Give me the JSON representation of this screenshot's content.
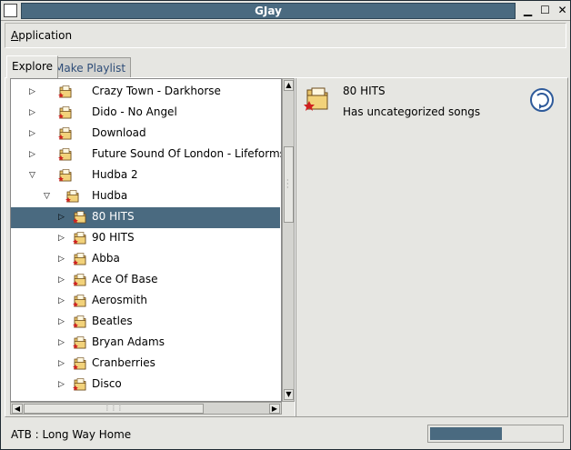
{
  "window": {
    "title": "GJay"
  },
  "menubar": {
    "application_label": "Application"
  },
  "tabs": [
    {
      "label": "Explore",
      "active": true
    },
    {
      "label": "Make Playlist",
      "active": false
    }
  ],
  "tree": {
    "rows": [
      {
        "label": "Crazy Town - Darkhorse",
        "depth": 0,
        "expanded": false,
        "selected": false
      },
      {
        "label": "Dido - No Angel",
        "depth": 0,
        "expanded": false,
        "selected": false
      },
      {
        "label": "Download",
        "depth": 0,
        "expanded": false,
        "selected": false
      },
      {
        "label": "Future Sound Of London - Lifeforms",
        "depth": 0,
        "expanded": false,
        "selected": false
      },
      {
        "label": "Hudba 2",
        "depth": 0,
        "expanded": true,
        "selected": false
      },
      {
        "label": "Hudba",
        "depth": 1,
        "expanded": true,
        "selected": false
      },
      {
        "label": "80 HITS",
        "depth": 2,
        "expanded": false,
        "selected": true
      },
      {
        "label": "90 HITS",
        "depth": 2,
        "expanded": false,
        "selected": false
      },
      {
        "label": "Abba",
        "depth": 2,
        "expanded": false,
        "selected": false
      },
      {
        "label": "Ace Of Base",
        "depth": 2,
        "expanded": false,
        "selected": false
      },
      {
        "label": "Aerosmith",
        "depth": 2,
        "expanded": false,
        "selected": false
      },
      {
        "label": "Beatles",
        "depth": 2,
        "expanded": false,
        "selected": false
      },
      {
        "label": "Bryan Adams",
        "depth": 2,
        "expanded": false,
        "selected": false
      },
      {
        "label": "Cranberries",
        "depth": 2,
        "expanded": false,
        "selected": false
      },
      {
        "label": "Disco",
        "depth": 2,
        "expanded": false,
        "selected": false
      }
    ]
  },
  "detail": {
    "title": "80 HITS",
    "subtitle": "Has uncategorized songs"
  },
  "statusbar": {
    "text": "ATB : Long Way Home",
    "progress": 0.55
  },
  "colors": {
    "selection": "#4a6a80",
    "title_bar": "#4a6a80",
    "folder": "#e8c46a",
    "folder_badge": "#d02020"
  },
  "icons": {
    "folder": "music-folder-icon",
    "refresh": "refresh-icon",
    "expander_collapsed": "triangle-right-icon",
    "expander_expanded": "triangle-down-icon"
  }
}
